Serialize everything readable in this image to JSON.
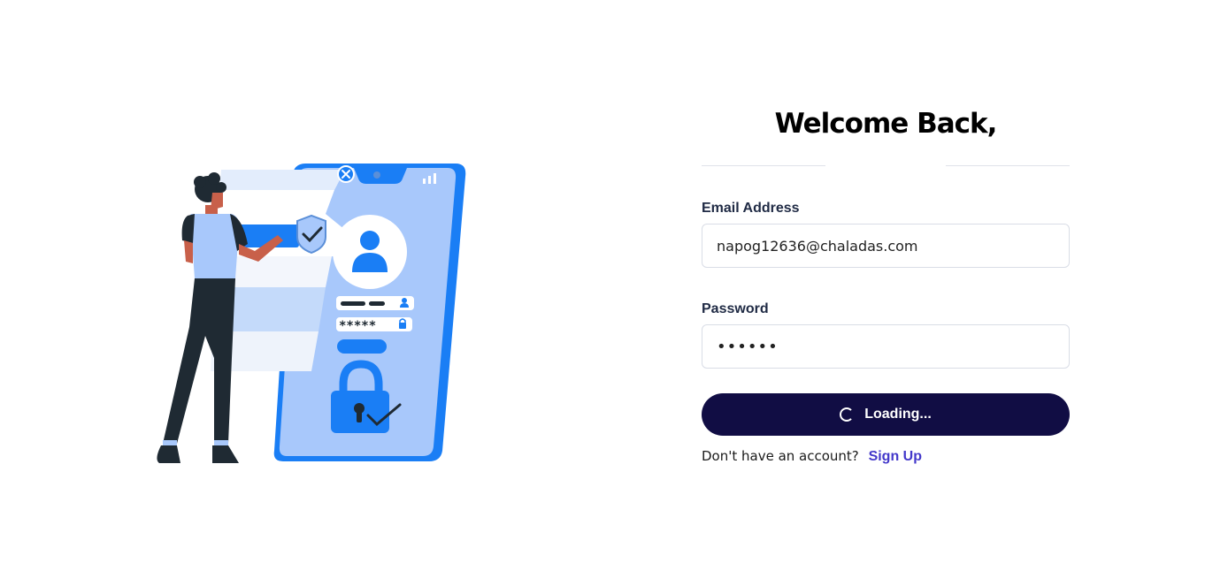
{
  "heading": {
    "title": "Welcome Back,"
  },
  "email": {
    "label": "Email Address",
    "value": "napog12636@chaladas.com"
  },
  "password": {
    "label": "Password",
    "masked_value": "••••••"
  },
  "submit": {
    "label": "Loading..."
  },
  "signup": {
    "prompt": "Don't have an account?",
    "link": "Sign Up"
  },
  "illustration_lock_text": "*****",
  "colors": {
    "primary_button": "#110d44",
    "link": "#4338ca",
    "illustration_blue": "#1a7ef5",
    "illustration_light_blue": "#a8c8fb"
  }
}
